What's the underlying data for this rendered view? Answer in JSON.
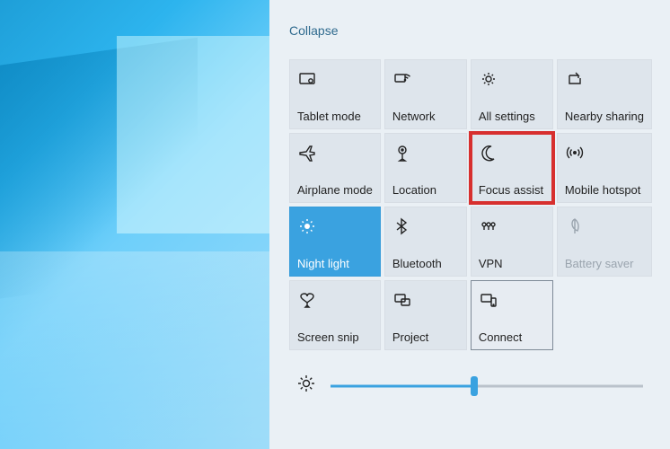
{
  "action_center": {
    "collapse_label": "Collapse",
    "tiles": [
      {
        "id": "tablet-mode",
        "label": "Tablet mode",
        "icon": "tablet-mode-icon",
        "state": "normal"
      },
      {
        "id": "network",
        "label": "Network",
        "icon": "network-icon",
        "state": "normal"
      },
      {
        "id": "all-settings",
        "label": "All settings",
        "icon": "gear-icon",
        "state": "normal"
      },
      {
        "id": "nearby-sharing",
        "label": "Nearby sharing",
        "icon": "share-icon",
        "state": "normal"
      },
      {
        "id": "airplane-mode",
        "label": "Airplane mode",
        "icon": "airplane-icon",
        "state": "normal"
      },
      {
        "id": "location",
        "label": "Location",
        "icon": "location-pin-icon",
        "state": "normal"
      },
      {
        "id": "focus-assist",
        "label": "Focus assist",
        "icon": "moon-icon",
        "state": "highlight-red"
      },
      {
        "id": "mobile-hotspot",
        "label": "Mobile hotspot",
        "icon": "hotspot-icon",
        "state": "normal"
      },
      {
        "id": "night-light",
        "label": "Night light",
        "icon": "night-light-icon",
        "state": "active"
      },
      {
        "id": "bluetooth",
        "label": "Bluetooth",
        "icon": "bluetooth-icon",
        "state": "normal"
      },
      {
        "id": "vpn",
        "label": "VPN",
        "icon": "vpn-icon",
        "state": "normal"
      },
      {
        "id": "battery-saver",
        "label": "Battery saver",
        "icon": "leaf-icon",
        "state": "disabled"
      },
      {
        "id": "screen-snip",
        "label": "Screen snip",
        "icon": "snip-icon",
        "state": "normal"
      },
      {
        "id": "project",
        "label": "Project",
        "icon": "project-icon",
        "state": "normal"
      },
      {
        "id": "connect",
        "label": "Connect",
        "icon": "connect-icon",
        "state": "outlined"
      }
    ],
    "brightness": {
      "percent": 46
    }
  },
  "colors": {
    "accent": "#3aa2e0",
    "highlight": "#d72f2e",
    "muted": "#9aa4ae"
  }
}
